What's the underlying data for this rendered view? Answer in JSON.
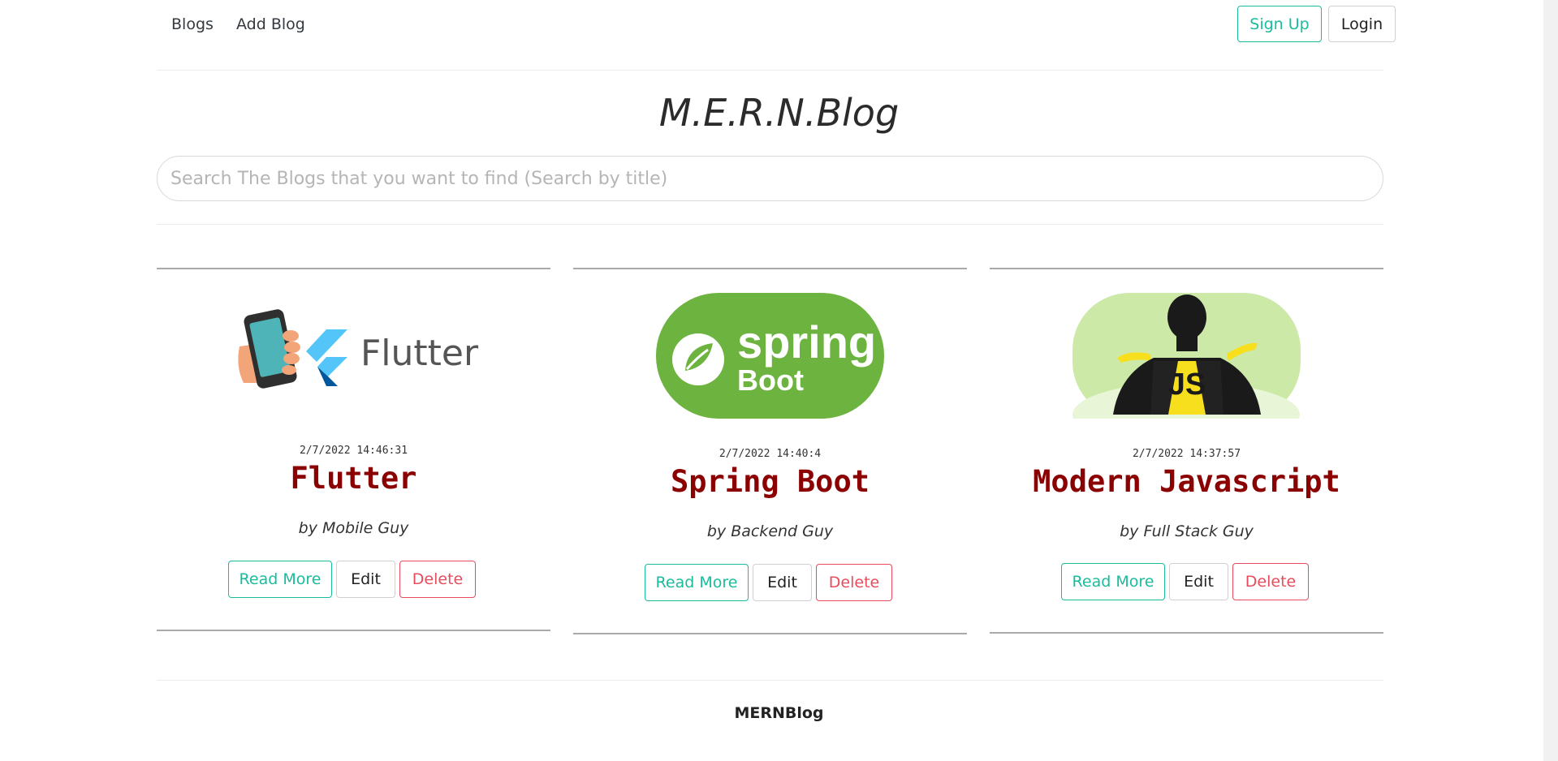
{
  "nav": {
    "links": [
      "Blogs",
      "Add Blog"
    ],
    "signup_label": "Sign Up",
    "login_label": "Login"
  },
  "site_title": "M.E.R.N.Blog",
  "search": {
    "placeholder": "Search The Blogs that you want to find (Search by title)",
    "value": ""
  },
  "cards": [
    {
      "date": "2/7/2022 14:46:31",
      "title": "Flutter",
      "author": "by Mobile Guy",
      "image_icon": "flutter-logo-icon",
      "buttons": [
        "Read More",
        "Edit",
        "Delete"
      ]
    },
    {
      "date": "2/7/2022 14:40:4",
      "title": "Spring Boot",
      "author": "by Backend Guy",
      "image_icon": "spring-boot-logo-icon",
      "image_text": [
        "spring",
        "Boot"
      ],
      "buttons": [
        "Read More",
        "Edit",
        "Delete"
      ]
    },
    {
      "date": "2/7/2022 14:37:57",
      "title": "Modern Javascript",
      "author": "by Full Stack Guy",
      "image_icon": "javascript-hero-icon",
      "image_text": [
        "JS"
      ],
      "buttons": [
        "Read More",
        "Edit",
        "Delete"
      ]
    }
  ],
  "footer": "MERNBlog",
  "colors": {
    "accent": "#1abc9c",
    "danger": "#e74c5c",
    "title": "#8b0000",
    "spring_green": "#6db33f",
    "js_yellow": "#f7df1e"
  }
}
